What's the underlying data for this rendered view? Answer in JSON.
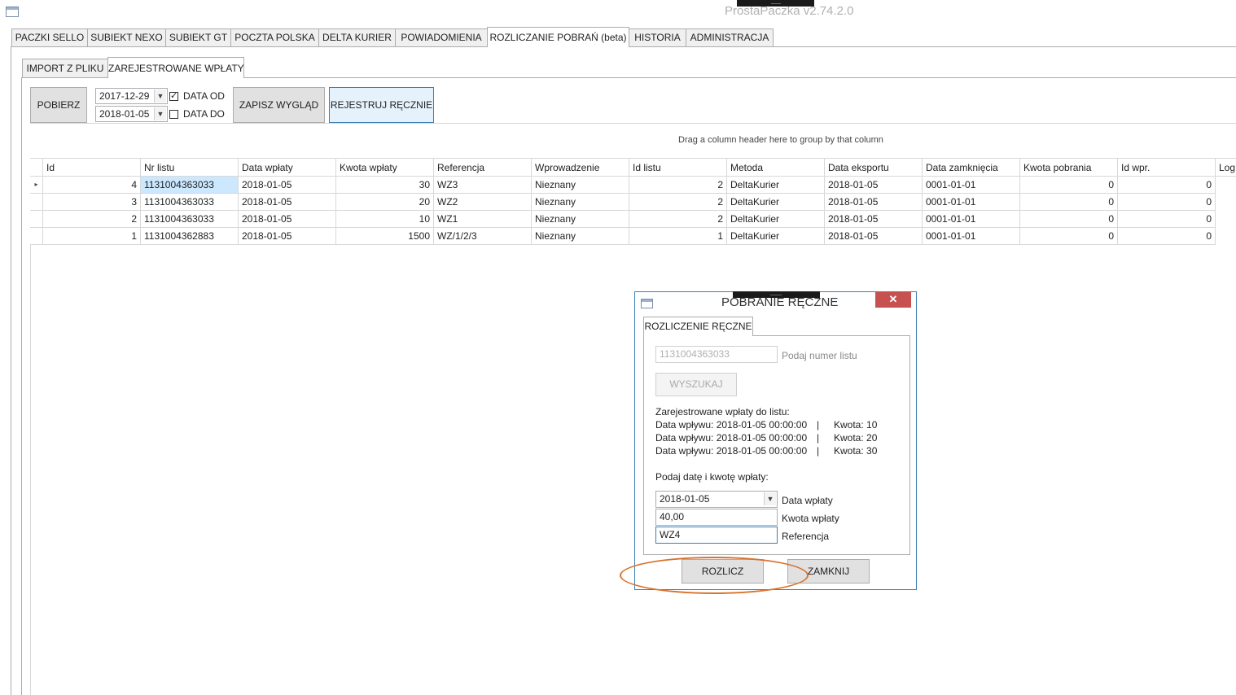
{
  "window": {
    "title": "ProstaPaczka v2.74.2.0"
  },
  "main_tabs": [
    {
      "label": "PACZKI SELLO"
    },
    {
      "label": "SUBIEKT NEXO"
    },
    {
      "label": "SUBIEKT GT"
    },
    {
      "label": "POCZTA POLSKA"
    },
    {
      "label": "DELTA KURIER"
    },
    {
      "label": "POWIADOMIENIA"
    },
    {
      "label": "ROZLICZANIE POBRAŃ (beta)"
    },
    {
      "label": "HISTORIA"
    },
    {
      "label": "ADMINISTRACJA"
    }
  ],
  "sub_tabs": [
    {
      "label": "IMPORT Z PLIKU"
    },
    {
      "label": "ZAREJESTROWANE WPŁATY"
    }
  ],
  "toolbar": {
    "fetch_label": "POBIERZ",
    "date_from": "2017-12-29",
    "date_to": "2018-01-05",
    "date_from_label": "DATA OD",
    "date_to_label": "DATA DO",
    "date_from_checked": "✓",
    "save_layout_label": "ZAPISZ WYGLĄD",
    "register_manual_label": "REJESTRUJ RĘCZNIE"
  },
  "grid": {
    "group_hint": "Drag a column header here to group by that column",
    "columns": [
      "Id",
      "Nr listu",
      "Data wpłaty",
      "Kwota wpłaty",
      "Referencja",
      "Wprowadzenie",
      "Id listu",
      "Metoda",
      "Data eksportu",
      "Data zamknięcia",
      "Kwota pobrania",
      "Id wpr.",
      "Log"
    ],
    "current_row_marker": "▸",
    "rows": [
      [
        "4",
        "1131004363033",
        "2018-01-05",
        "30",
        "WZ3",
        "Nieznany",
        "2",
        "DeltaKurier",
        "2018-01-05",
        "0001-01-01",
        "0",
        "0"
      ],
      [
        "3",
        "1131004363033",
        "2018-01-05",
        "20",
        "WZ2",
        "Nieznany",
        "2",
        "DeltaKurier",
        "2018-01-05",
        "0001-01-01",
        "0",
        "0"
      ],
      [
        "2",
        "1131004363033",
        "2018-01-05",
        "10",
        "WZ1",
        "Nieznany",
        "2",
        "DeltaKurier",
        "2018-01-05",
        "0001-01-01",
        "0",
        "0"
      ],
      [
        "1",
        "1131004362883",
        "2018-01-05",
        "1500",
        "WZ/1/2/3",
        "Nieznany",
        "1",
        "DeltaKurier",
        "2018-01-05",
        "0001-01-01",
        "0",
        "0"
      ]
    ]
  },
  "dialog": {
    "title": "POBRANIE RĘCZNE",
    "close_glyph": "✕",
    "tab_label": "ROZLICZENIE RĘCZNE",
    "shipment_number_value": "1131004363033",
    "shipment_number_label": "Podaj numer listu",
    "search_label": "WYSZUKAJ",
    "registered_header": "Zarejestrowane wpłaty do listu:",
    "registered_lines": [
      {
        "date": "Data wpływu: 2018-01-05 00:00:00",
        "sep": "|",
        "amount": "Kwota: 10"
      },
      {
        "date": "Data wpływu: 2018-01-05 00:00:00",
        "sep": "|",
        "amount": "Kwota: 20"
      },
      {
        "date": "Data wpływu: 2018-01-05 00:00:00",
        "sep": "|",
        "amount": "Kwota: 30"
      }
    ],
    "enter_prompt": "Podaj datę i kwotę wpłaty:",
    "payment_date_value": "2018-01-05",
    "payment_date_label": "Data wpłaty",
    "payment_amount_value": "40,00",
    "payment_amount_label": "Kwota wpłaty",
    "reference_value": "WZ4",
    "reference_label": "Referencja",
    "settle_label": "ROZLICZ",
    "close_label": "ZAMKNIJ"
  }
}
